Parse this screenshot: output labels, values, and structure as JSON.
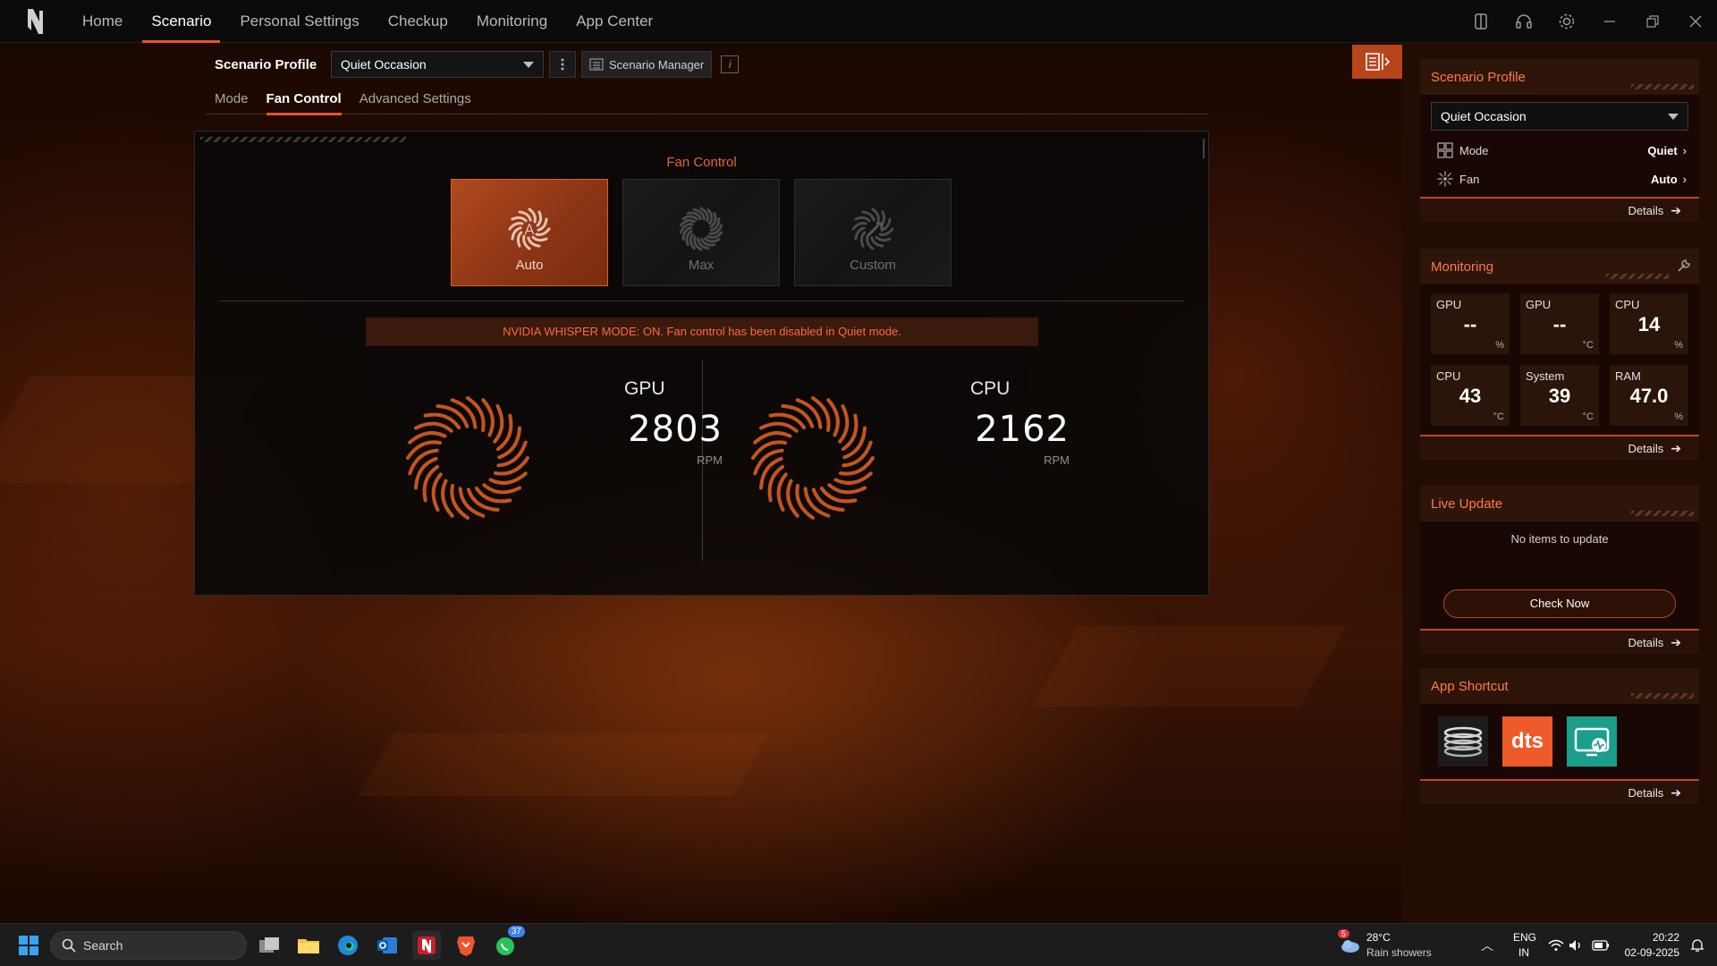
{
  "nav": {
    "items": [
      "Home",
      "Scenario",
      "Personal Settings",
      "Checkup",
      "Monitoring",
      "App Center"
    ],
    "active": "Scenario"
  },
  "profile": {
    "label": "Scenario Profile",
    "selected": "Quiet Occasion",
    "manager_label": "Scenario Manager",
    "info_glyph": "i"
  },
  "subtabs": [
    "Mode",
    "Fan Control",
    "Advanced Settings"
  ],
  "fan_control": {
    "title": "Fan Control",
    "modes": [
      "Auto",
      "Max",
      "Custom"
    ],
    "selected_mode": "Auto",
    "warning": "NVIDIA WHISPER MODE: ON. Fan control has been disabled in Quiet mode.",
    "gpu": {
      "name": "GPU",
      "value": "2803",
      "unit": "RPM"
    },
    "cpu": {
      "name": "CPU",
      "value": "2162",
      "unit": "RPM"
    }
  },
  "sidebar": {
    "scenario_profile": {
      "title": "Scenario Profile",
      "selected": "Quiet Occasion",
      "rows": [
        {
          "label": "Mode",
          "value": "Quiet",
          "icon": "grid-icon"
        },
        {
          "label": "Fan",
          "value": "Auto",
          "icon": "fan-icon"
        }
      ],
      "details": "Details"
    },
    "monitoring": {
      "title": "Monitoring",
      "cells": [
        {
          "name": "GPU",
          "value": "--",
          "unit": "%"
        },
        {
          "name": "GPU",
          "value": "--",
          "unit": "°C"
        },
        {
          "name": "CPU",
          "value": "14",
          "unit": "%"
        },
        {
          "name": "CPU",
          "value": "43",
          "unit": "°C"
        },
        {
          "name": "System",
          "value": "39",
          "unit": "°C"
        },
        {
          "name": "RAM",
          "value": "47.0",
          "unit": "%"
        }
      ],
      "details": "Details"
    },
    "live_update": {
      "title": "Live Update",
      "message": "No items to update",
      "button": "Check Now",
      "details": "Details"
    },
    "app_shortcut": {
      "title": "App Shortcut",
      "apps": [
        "coil-app-icon",
        "dts-app-icon",
        "monitor-app-icon"
      ],
      "dts_text": "dts",
      "details": "Details"
    }
  },
  "taskbar": {
    "search_placeholder": "Search",
    "whatsapp_badge": "37",
    "weather_badge": "5",
    "weather_temp": "28°C",
    "weather_desc": "Rain showers",
    "lang_top": "ENG",
    "lang_bottom": "IN",
    "time": "20:22",
    "date": "02-09-2025"
  },
  "colors": {
    "accent": "#e4562a",
    "warning_text": "#ff6a3a",
    "active_fan": "#b0491f"
  }
}
